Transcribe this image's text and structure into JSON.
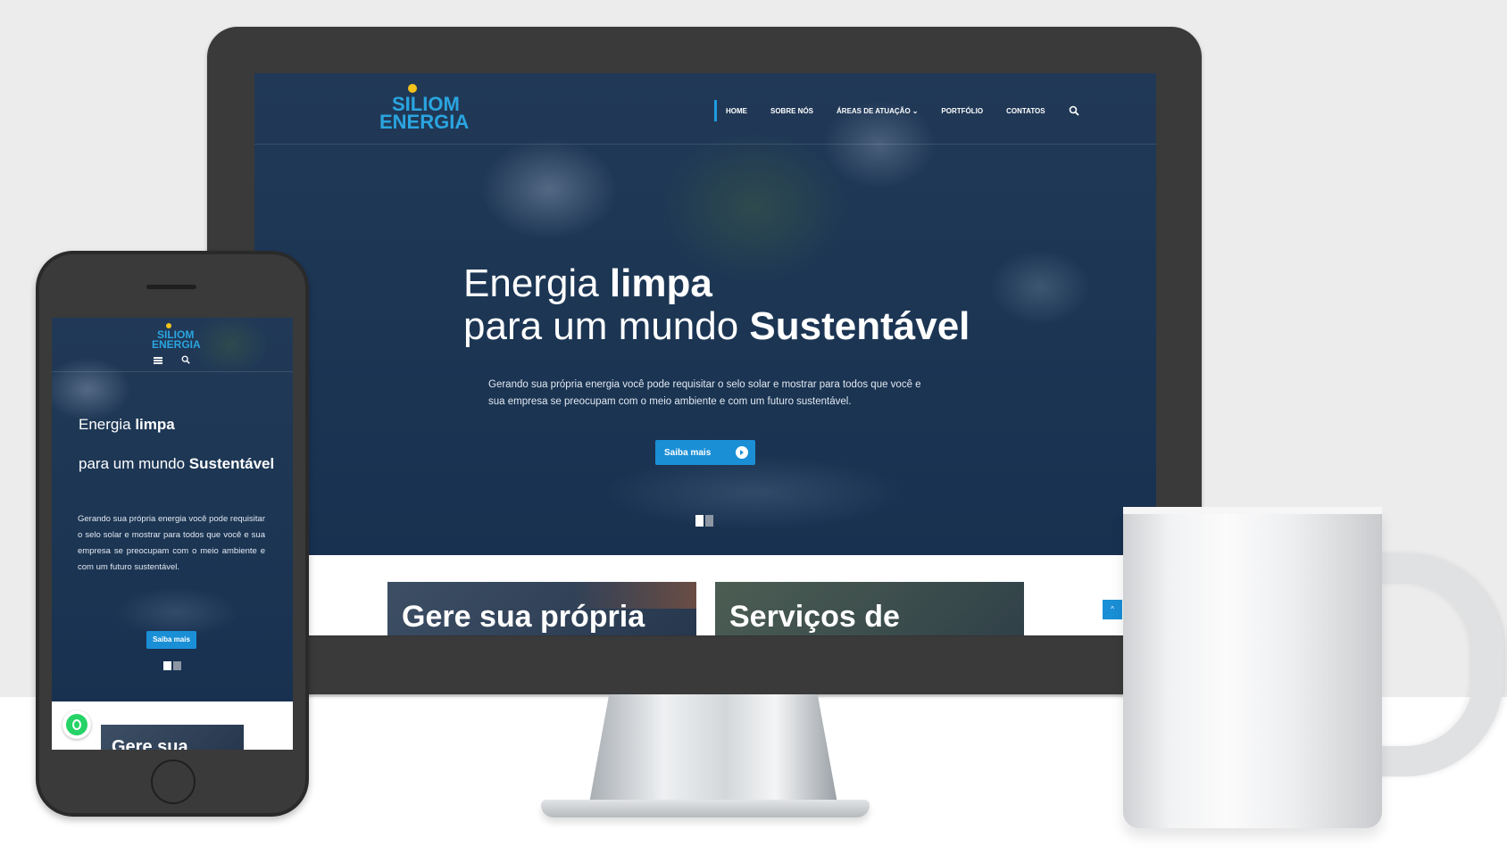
{
  "desktop": {
    "logo": {
      "line1": "SILIOM",
      "line2": "ENERGIA"
    },
    "nav": {
      "items": [
        "HOME",
        "SOBRE NÓS",
        "ÁREAS DE ATUAÇÃO",
        "PORTFÓLIO",
        "CONTATOS"
      ],
      "active_item": "HOME",
      "dropdown_caret": "⌄",
      "search_icon": "search-icon"
    },
    "hero": {
      "title_light_1": "Energia ",
      "title_bold_1": "limpa",
      "title_light_2": "para um mundo ",
      "title_bold_2": "Sustentável",
      "description": "Gerando sua própria energia você pode requisitar o selo solar e mostrar para todos que você e sua empresa se preocupam com o meio ambiente e com um futuro sustentável.",
      "button_label": "Saiba mais",
      "slides": 2,
      "active_slide": 1
    },
    "cards": [
      {
        "title": "Gere sua própria"
      },
      {
        "title": "Serviços de"
      }
    ],
    "scroll_top_icon": "^"
  },
  "mobile": {
    "logo": {
      "line1": "SILIOM",
      "line2": "ENERGIA"
    },
    "menu_icon": "hamburger-icon",
    "search_icon": "search-icon",
    "hero": {
      "title_light_1": "Energia ",
      "title_bold_1": "limpa",
      "title_light_2": "para um mundo ",
      "title_bold_2": "Sustentável",
      "description": "Gerando sua própria energia você pode requisitar o selo solar e mostrar para todos que você e sua empresa se preocupam com o meio ambiente e com um futuro sustentável.",
      "button_label": "Saiba mais"
    },
    "card_title": "Gere sua",
    "whatsapp_icon": "whatsapp-icon"
  },
  "colors": {
    "accent": "#1a8fd6",
    "logo_blue": "#2aa5e0",
    "logo_sun": "#f4c21a",
    "hero_bg": "#1c3654",
    "device_body": "#3a3a3a"
  }
}
